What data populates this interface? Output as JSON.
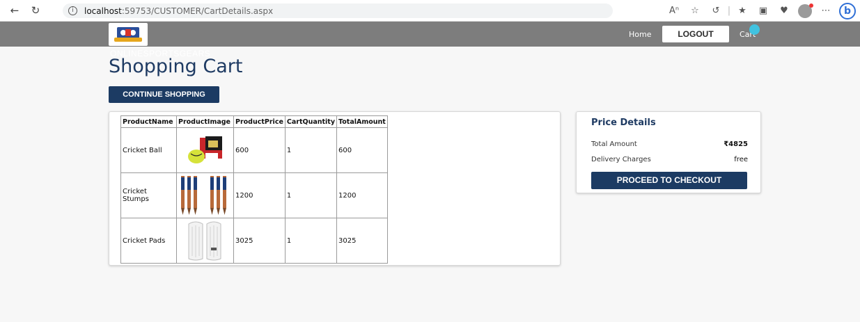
{
  "browser": {
    "back_icon": "back-arrow-icon",
    "refresh_icon": "refresh-icon",
    "url_host": "localhost",
    "url_path": ":59753/CUSTOMER/CartDetails.aspx"
  },
  "header": {
    "brand": "ONLINESPORTSGEARS",
    "home": "Home",
    "logout": "LOGOUT",
    "cart": "Cart",
    "cart_badge_color": "#41c3e0",
    "bar_color": "#7d7d7d"
  },
  "main": {
    "title": "Shopping Cart",
    "continue_button": "CONTINUE SHOPPING",
    "table": {
      "headers": [
        "ProductName",
        "ProductImage",
        "ProductPrice",
        "CartQuantity",
        "TotalAmount"
      ],
      "rows": [
        {
          "name": "Cricket Ball",
          "image": "cricket-ball-image",
          "price": "600",
          "quantity": "1",
          "total": "600"
        },
        {
          "name": "Cricket Stumps",
          "image": "cricket-stumps-image",
          "price": "1200",
          "quantity": "1",
          "total": "1200"
        },
        {
          "name": "Cricket Pads",
          "image": "cricket-pads-image",
          "price": "3025",
          "quantity": "1",
          "total": "3025"
        }
      ]
    }
  },
  "price_details": {
    "title": "Price Details",
    "total_label": "Total Amount",
    "total_value": "₹4825",
    "delivery_label": "Delivery Charges",
    "delivery_value": "free",
    "checkout_button": "PROCEED TO CHECKOUT",
    "accent_color": "#1c3b63"
  }
}
